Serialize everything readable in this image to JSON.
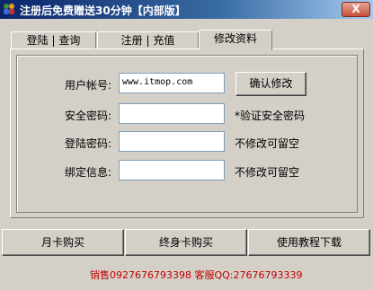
{
  "window": {
    "title": "注册后免费赠送30分钟【内部版】",
    "close_label": "X"
  },
  "tabs": [
    {
      "label": "登陆 | 查询"
    },
    {
      "label": "注册 | 充值"
    },
    {
      "label": "修改资料",
      "active": true
    }
  ],
  "form": {
    "account_label": "用户帐号:",
    "account_value": "www.itmop.com",
    "confirm_button": "确认修改",
    "password_label": "安全密码:",
    "password_hint": "*验证安全密码",
    "login_password_label": "登陆密码:",
    "login_password_hint": "不修改可留空",
    "bind_info_label": "绑定信息:",
    "bind_info_hint": "不修改可留空"
  },
  "bottom_buttons": {
    "monthly": "月卡购买",
    "lifetime": "终身卡购买",
    "tutorial": "使用教程下载"
  },
  "status": {
    "text": "销售0927676793398 客服QQ:27676793339"
  },
  "colors": {
    "face": "#d4d0c8",
    "title_start": "#0a246a",
    "status_text": "#c00000"
  }
}
